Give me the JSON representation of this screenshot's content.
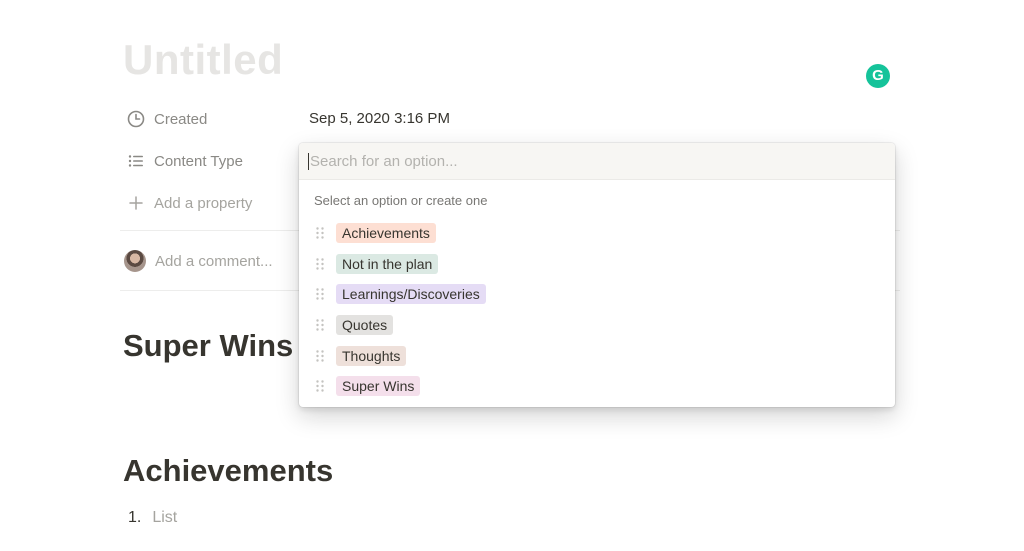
{
  "page": {
    "title": "Untitled"
  },
  "extension": {
    "letter": "G",
    "color": "#15c39a"
  },
  "properties": [
    {
      "icon": "clock-icon",
      "label": "Created",
      "value": "Sep 5, 2020 3:16 PM"
    },
    {
      "icon": "list-icon",
      "label": "Content Type",
      "value": ""
    },
    {
      "icon": "plus-icon",
      "label": "Add a property"
    }
  ],
  "comment": {
    "placeholder": "Add a comment..."
  },
  "dropdown": {
    "search_placeholder": "Search for an option...",
    "hint": "Select an option or create one",
    "options": [
      {
        "label": "Achievements",
        "color": "#fddfd3"
      },
      {
        "label": "Not in the plan",
        "color": "#dbe9e3"
      },
      {
        "label": "Learnings/Discoveries",
        "color": "#e5dcf5"
      },
      {
        "label": "Quotes",
        "color": "#e3e2e0"
      },
      {
        "label": "Thoughts",
        "color": "#eee0da"
      },
      {
        "label": "Super Wins",
        "color": "#f4dfeb"
      }
    ]
  },
  "content": {
    "heading1": "Super Wins",
    "heading2": "Achievements",
    "list_number": "1.",
    "list_placeholder": "List"
  }
}
